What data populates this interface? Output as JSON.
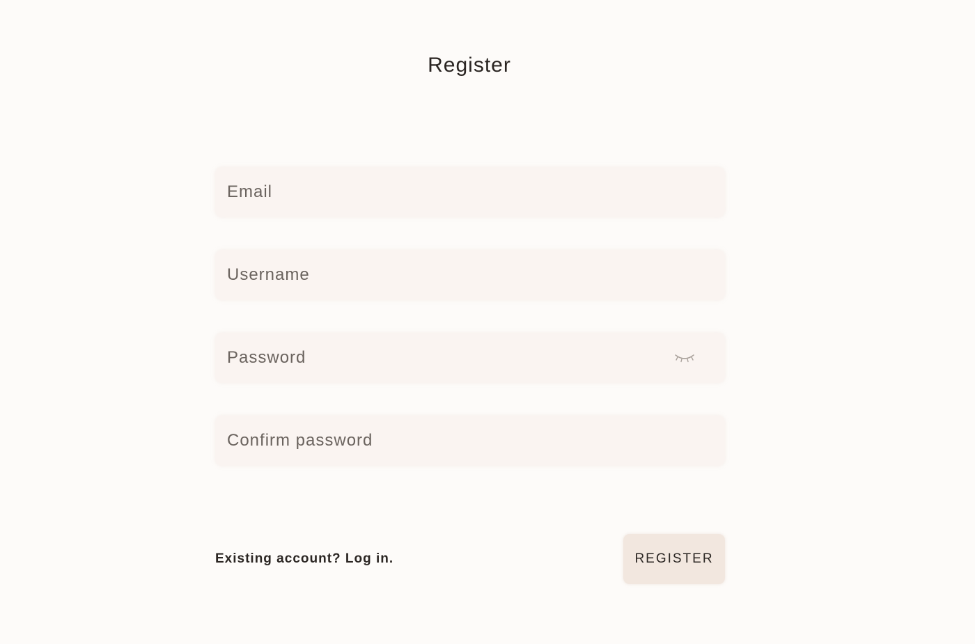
{
  "page": {
    "title": "Register"
  },
  "form": {
    "email": {
      "placeholder": "Email",
      "value": ""
    },
    "username": {
      "placeholder": "Username",
      "value": ""
    },
    "password": {
      "placeholder": "Password",
      "value": "",
      "toggle_icon": "eye-closed-icon"
    },
    "confirm_password": {
      "placeholder": "Confirm password",
      "value": ""
    }
  },
  "footer": {
    "login_link": "Existing account? Log in.",
    "register_label": "REGISTER"
  },
  "colors": {
    "background": "#fdfbf9",
    "field_background": "#faf4f1",
    "button_background": "#f2e7df",
    "text": "#2b2623"
  }
}
